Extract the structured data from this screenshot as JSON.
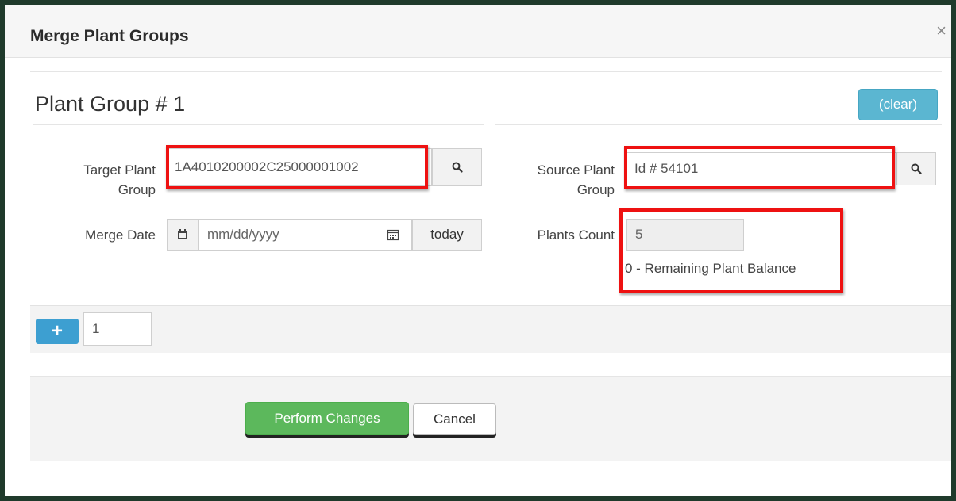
{
  "modal": {
    "title": "Merge Plant Groups",
    "close_glyph": "×"
  },
  "group": {
    "title": "Plant Group # 1",
    "clear_label": "(clear)"
  },
  "target": {
    "label_line1": "Target Plant",
    "label_line2": "Group",
    "value": "1A4010200002C25000001002",
    "search_icon": "search-icon"
  },
  "merge_date": {
    "label": "Merge Date",
    "placeholder": "mm/dd/yyyy",
    "today_label": "today"
  },
  "source": {
    "label_line1": "Source Plant",
    "label_line2": "Group",
    "value": "Id # 54101"
  },
  "plants_count": {
    "label": "Plants Count",
    "value": "5",
    "remaining_text": "0 - Remaining Plant Balance"
  },
  "adder": {
    "plus_label": "+",
    "count": "1"
  },
  "footer": {
    "perform_label": "Perform Changes",
    "cancel_label": "Cancel"
  },
  "colors": {
    "primary": "#5bb6d1",
    "success": "#5cb85c",
    "highlight": "#ee1111",
    "backdrop": "#1f3a2b"
  }
}
